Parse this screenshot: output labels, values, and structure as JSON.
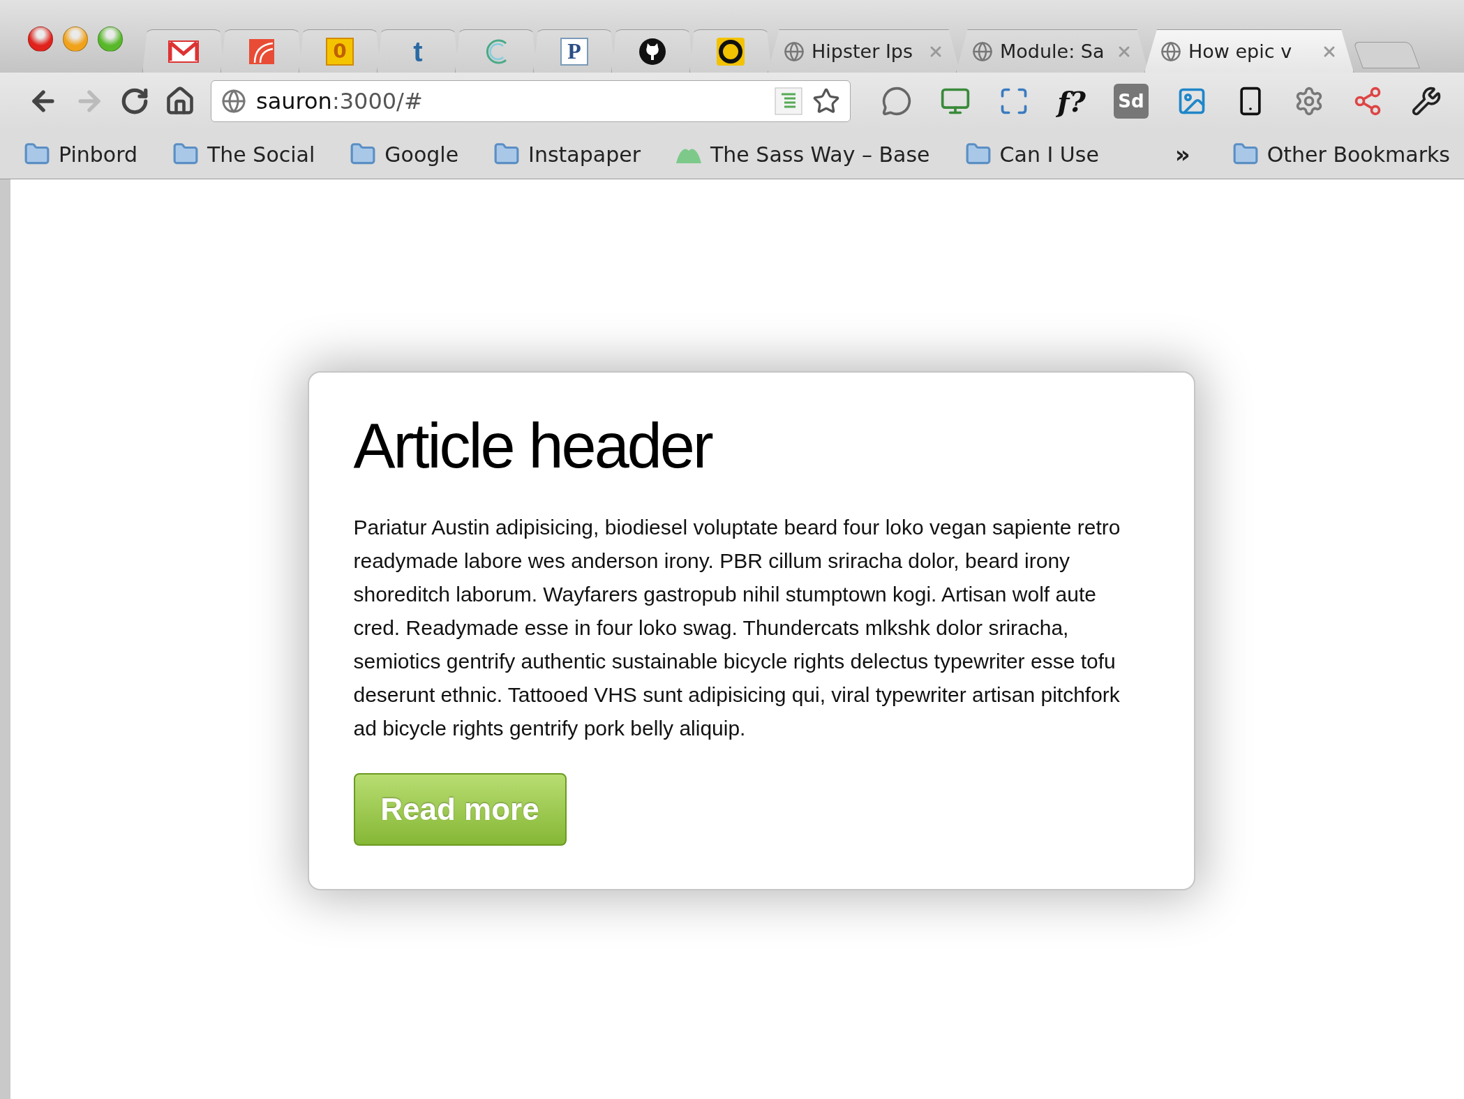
{
  "pinned_tabs": [
    {
      "kind": "gmail",
      "selected": false
    },
    {
      "kind": "red-square",
      "selected": false
    },
    {
      "kind": "yellow-glyph",
      "glyph": "0",
      "selected": false
    },
    {
      "kind": "letter",
      "glyph": "t",
      "selected": false
    },
    {
      "kind": "arcs",
      "selected": false
    },
    {
      "kind": "boxed-letter",
      "glyph": "P",
      "selected": false
    },
    {
      "kind": "octocat",
      "selected": false
    },
    {
      "kind": "ring",
      "selected": false
    }
  ],
  "tabs": [
    {
      "title": "Hipster Ips",
      "selected": false
    },
    {
      "title": "Module: Sa",
      "selected": false
    },
    {
      "title": "How epic v",
      "selected": true
    }
  ],
  "address_bar": {
    "host": "sauron",
    "rest": ":3000/#"
  },
  "extensions": [
    {
      "kind": "chat"
    },
    {
      "kind": "monitor"
    },
    {
      "kind": "frame"
    },
    {
      "kind": "text",
      "glyph": "f?"
    },
    {
      "kind": "badge",
      "glyph": "Sd"
    },
    {
      "kind": "picture"
    },
    {
      "kind": "device"
    },
    {
      "kind": "gear"
    },
    {
      "kind": "nodes"
    },
    {
      "kind": "wrench"
    }
  ],
  "bookmarks": [
    {
      "kind": "folder",
      "label": "Pinbord"
    },
    {
      "kind": "folder",
      "label": "The Social"
    },
    {
      "kind": "folder",
      "label": "Google"
    },
    {
      "kind": "folder",
      "label": "Instapaper"
    },
    {
      "kind": "site",
      "label": "The Sass Way – Base"
    },
    {
      "kind": "folder",
      "label": "Can I Use"
    }
  ],
  "bookmarks_overflow": "»",
  "other_bookmarks": "Other Bookmarks",
  "article": {
    "title": "Article header",
    "body": "Pariatur Austin adipisicing, biodiesel voluptate beard four loko vegan sapiente retro readymade labore wes anderson irony. PBR cillum sriracha dolor, beard irony shoreditch laborum. Wayfarers gastropub nihil stumptown kogi. Artisan wolf aute cred. Readymade esse in four loko swag. Thundercats mlkshk dolor sriracha, semiotics gentrify authentic sustainable bicycle rights delectus typewriter esse tofu deserunt ethnic. Tattooed VHS sunt adipisicing qui, viral typewriter artisan pitchfork ad bicycle rights gentrify pork belly aliquip.",
    "button": "Read more"
  }
}
